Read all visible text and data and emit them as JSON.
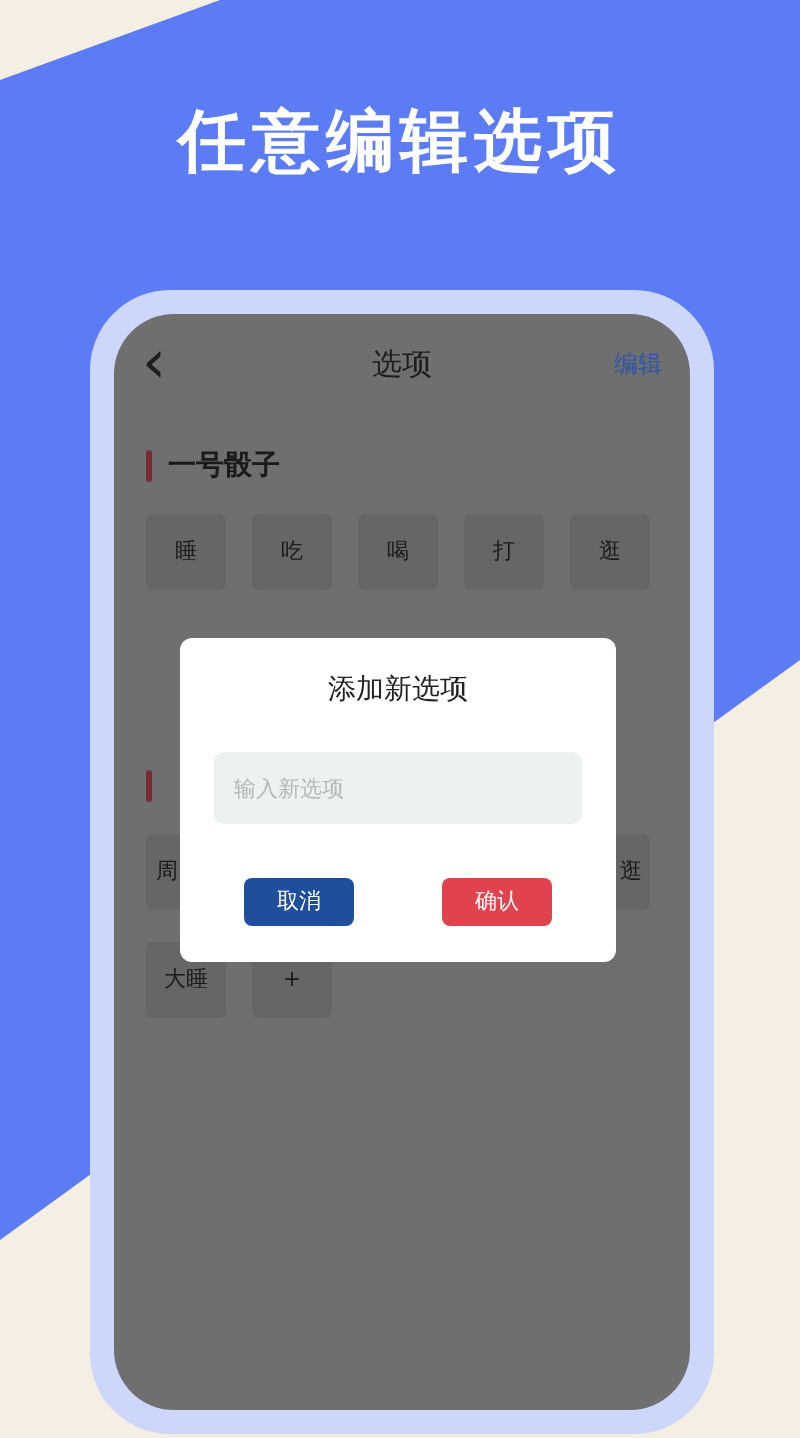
{
  "headline": "任意编辑选项",
  "nav": {
    "back": "‹",
    "title": "选项",
    "action": "编辑"
  },
  "sections": [
    {
      "title": "一号骰子",
      "rows": [
        [
          "睡",
          "吃",
          "喝",
          "打",
          "逛"
        ]
      ]
    },
    {
      "rows": [
        [
          "周",
          "",
          "",
          "",
          "逛"
        ],
        [
          "大睡",
          "+"
        ]
      ]
    }
  ],
  "dialog": {
    "title": "添加新选项",
    "placeholder": "输入新选项",
    "buttons": [
      {
        "label": "取消",
        "kind": "cancel"
      },
      {
        "label": "确认",
        "kind": "confirm"
      }
    ]
  }
}
